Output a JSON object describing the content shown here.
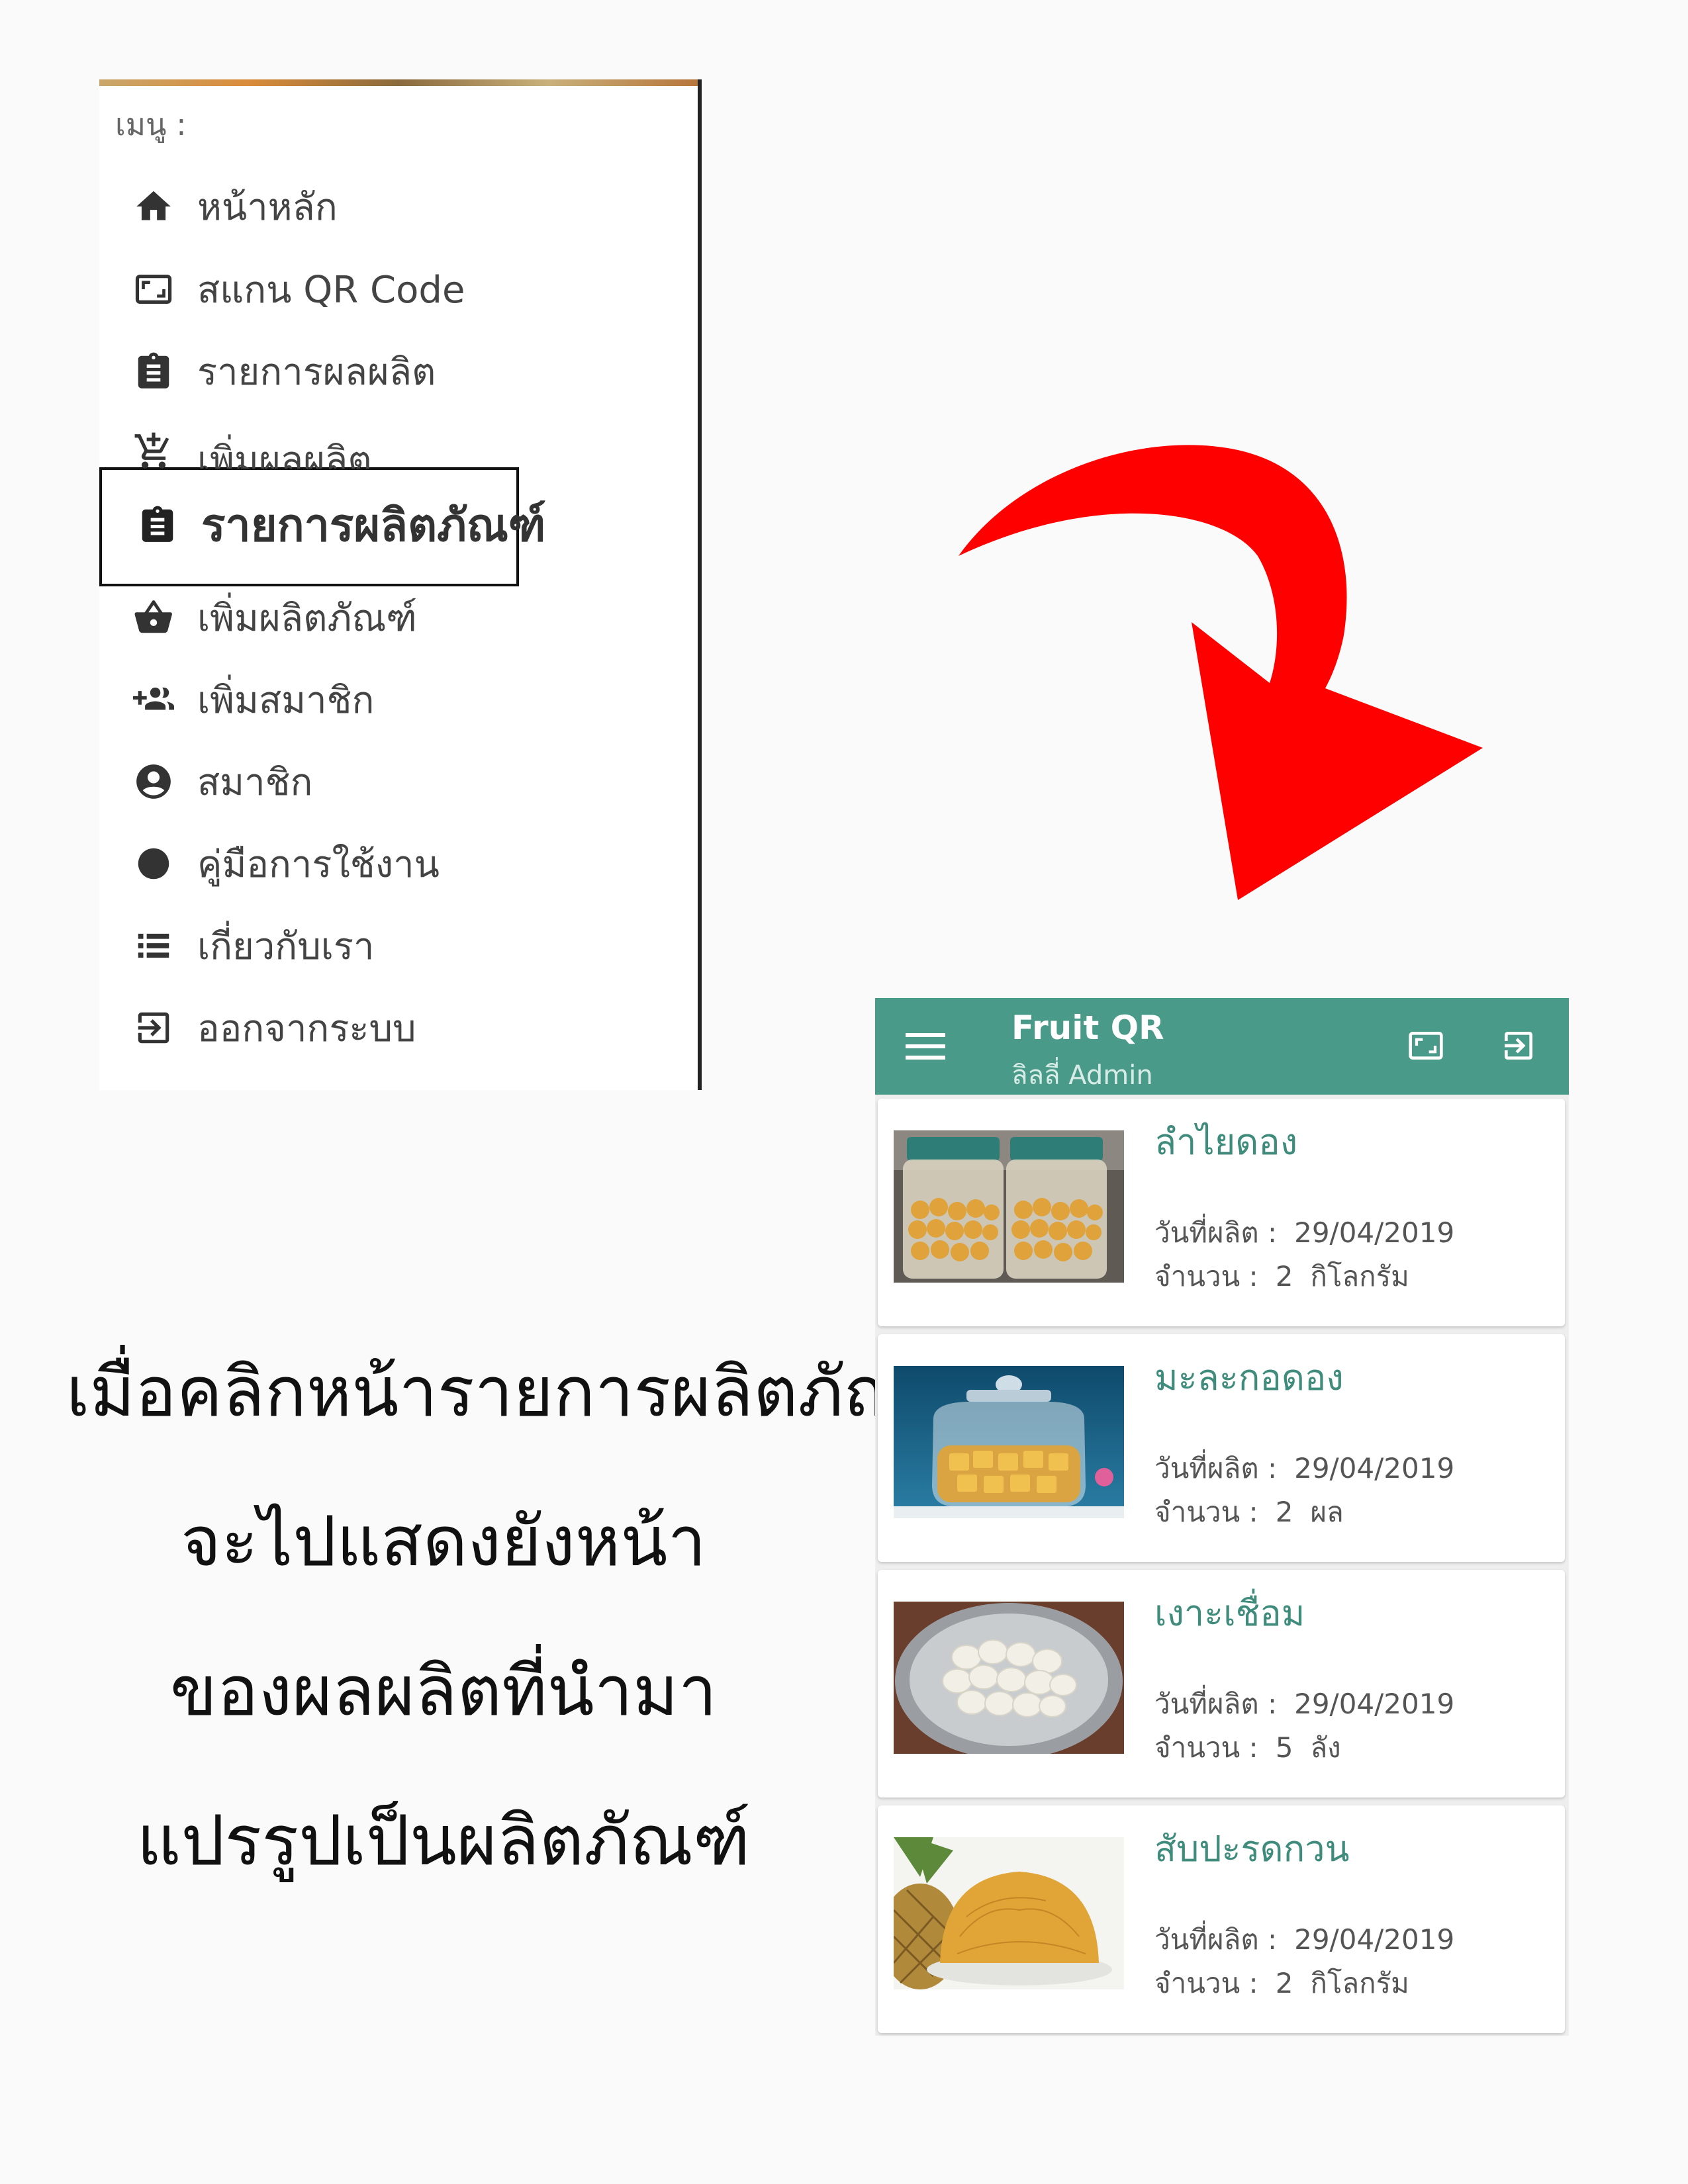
{
  "menu": {
    "header": "เมนู :",
    "items": [
      {
        "label": "หน้าหลัก",
        "icon": "home-icon"
      },
      {
        "label": "สแกน QR Code",
        "icon": "qr-scan-icon"
      },
      {
        "label": "รายการผลผลิต",
        "icon": "clipboard-icon"
      },
      {
        "label": "เพิ่มผลผลิต",
        "icon": "add-cart-icon"
      },
      {
        "label": "รายการผลิตภัณฑ์",
        "icon": "clipboard-icon",
        "selected": true
      },
      {
        "label": "เพิ่มผลิตภัณฑ์",
        "icon": "basket-icon"
      },
      {
        "label": "เพิ่มสมาชิก",
        "icon": "add-group-icon"
      },
      {
        "label": "สมาชิก",
        "icon": "account-circle-icon"
      },
      {
        "label": "คู่มือการใช้งาน",
        "icon": "circle-icon"
      },
      {
        "label": "เกี่ยวกับเรา",
        "icon": "list-icon"
      },
      {
        "label": "ออกจากระบบ",
        "icon": "exit-icon"
      }
    ]
  },
  "caption": {
    "lines": [
      "เมื่อคลิกหน้ารายการผลิตภัณฑ์",
      "จะไปแสดงยังหน้า",
      "ของผลผลิตที่นำมา",
      "แปรรูปเป็นผลิตภัณฑ์"
    ]
  },
  "app": {
    "title": "Fruit QR",
    "subtitle": "ลิลลี่ Admin",
    "bar_color": "#4a9a89",
    "accent_color": "#3f8c7c",
    "arrow_color": "#ff0000"
  },
  "products": [
    {
      "name": "ลำไยดอง",
      "date_label": "วันที่ผลิต :",
      "date": "29/04/2019",
      "qty_label": "จำนวน :",
      "qty": "2",
      "unit": "กิโลกรัม"
    },
    {
      "name": "มะละกอดอง",
      "date_label": "วันที่ผลิต :",
      "date": "29/04/2019",
      "qty_label": "จำนวน :",
      "qty": "2",
      "unit": "ผล"
    },
    {
      "name": "เงาะเชื่อม",
      "date_label": "วันที่ผลิต :",
      "date": "29/04/2019",
      "qty_label": "จำนวน :",
      "qty": "5",
      "unit": "ลัง"
    },
    {
      "name": "สับปะรดกวน",
      "date_label": "วันที่ผลิต :",
      "date": "29/04/2019",
      "qty_label": "จำนวน :",
      "qty": "2",
      "unit": "กิโลกรัม"
    }
  ]
}
